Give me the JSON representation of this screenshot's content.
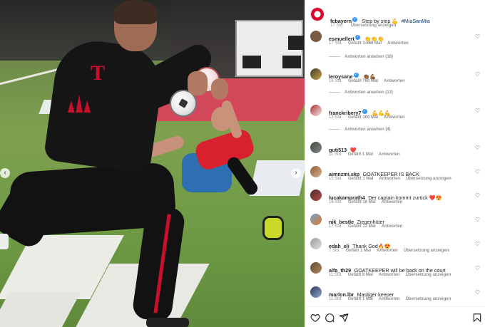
{
  "post": {
    "account": "fcbayern",
    "caption": "Step by step 💪",
    "hashtag": "#MiaSanMia",
    "time": "17 Std.",
    "translate": "Übersetzung anzeigen"
  },
  "comments": [
    {
      "user": "esmuellert",
      "verified": true,
      "text": "👏👏👏",
      "time": "17 Std.",
      "likes": "Gefällt 1.666 Mal",
      "reply": "Antworten",
      "translate": "",
      "replies": "Antworten ansehen (18)"
    },
    {
      "user": "leroysane",
      "verified": true,
      "text": "👏🏾💪🏾",
      "time": "16 Std.",
      "likes": "Gefällt 760 Mal",
      "reply": "Antworten",
      "translate": "",
      "replies": "Antworten ansehen (13)"
    },
    {
      "user": "franckribery7",
      "verified": true,
      "text": "💪💪💪",
      "time": "13 Std.",
      "likes": "Gefällt 300 Mal",
      "reply": "Antworten",
      "translate": "",
      "replies": "Antworten ansehen (4)"
    },
    {
      "user": "guti513",
      "verified": false,
      "text": "❤️",
      "time": "11 Std.",
      "likes": "Gefällt 1 Mal",
      "reply": "Antworten",
      "translate": "",
      "replies": ""
    },
    {
      "user": "aimnzmi.skp",
      "verified": false,
      "text": "GOATKEEPER IS BACK",
      "time": "15 Std.",
      "likes": "Gefällt 1 Mal",
      "reply": "Antworten",
      "translate": "Übersetzung anzeigen",
      "replies": ""
    },
    {
      "user": "lucakamprath4",
      "verified": false,
      "text": "Der captain kommt zurück ❤️😍",
      "time": "16 Std.",
      "likes": "Gefällt 16 Mal",
      "reply": "Antworten",
      "translate": "",
      "replies": ""
    },
    {
      "user": "nik_bestle",
      "verified": false,
      "text": "Ziegenhüter",
      "time": "17 Std.",
      "likes": "Gefällt 13 Mal",
      "reply": "Antworten",
      "translate": "",
      "replies": ""
    },
    {
      "user": "edah_eli",
      "verified": false,
      "text": "Thank God🔥😍",
      "time": "7 Std.",
      "likes": "Gefällt 1 Mal",
      "reply": "Antworten",
      "translate": "Übersetzung anzeigen",
      "replies": ""
    },
    {
      "user": "alfa_th29",
      "verified": false,
      "text": "GOATKEEPER will be back on the court",
      "time": "11 Std.",
      "likes": "Gefällt 8 Mal",
      "reply": "Antworten",
      "translate": "Übersetzung anzeigen",
      "replies": ""
    },
    {
      "user": "marlon.lbr",
      "verified": false,
      "text": "Mastiger keeper",
      "time": "11 Std.",
      "likes": "Gefällt 1 Mal",
      "reply": "Antworten",
      "translate": "Übersetzung anzeigen",
      "replies": ""
    }
  ],
  "icons": {
    "like": "heart-icon",
    "comment": "comment-icon",
    "share": "send-icon",
    "save": "bookmark-icon",
    "prev": "chevron-left-icon",
    "next": "chevron-right-icon"
  },
  "colors": {
    "link": "#00376b",
    "verified": "#3897f0",
    "muted": "#8e8e8e",
    "brand": "#dc052d"
  }
}
